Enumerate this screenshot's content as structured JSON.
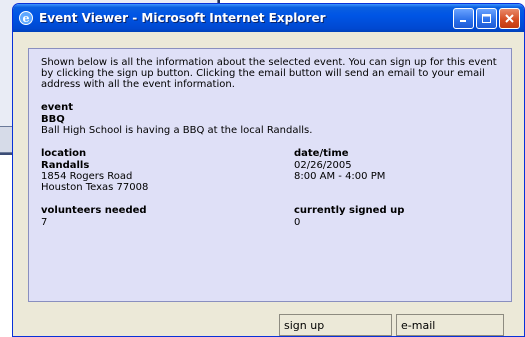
{
  "window": {
    "title": "Event Viewer - Microsoft Internet Explorer"
  },
  "intro": "Shown below is all the information about the selected event. You can sign up for this event by clicking the sign up button. Clicking the email button will send an email to your email address with all the event information.",
  "event": {
    "label": "event",
    "name": "BBQ",
    "description": "Ball High School is having a BBQ at the local Randalls."
  },
  "location": {
    "label": "location",
    "name": "Randalls",
    "address1": "1854 Rogers Road",
    "address2": "Houston Texas 77008"
  },
  "datetime": {
    "label": "date/time",
    "date": "02/26/2005",
    "time": "8:00 AM - 4:00 PM"
  },
  "volunteers": {
    "label": "volunteers needed",
    "value": "7"
  },
  "signed_up": {
    "label": "currently signed up",
    "value": "0"
  },
  "buttons": {
    "signup": "sign up",
    "email": "e-mail"
  }
}
